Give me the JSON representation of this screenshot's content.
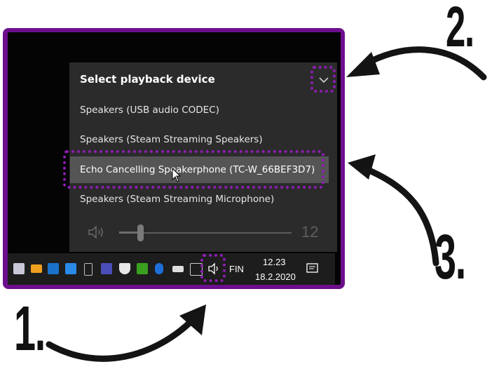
{
  "flyout": {
    "title": "Select playback device",
    "devices": [
      {
        "label": "Speakers (USB audio CODEC)",
        "selected": false
      },
      {
        "label": "Speakers (Steam Streaming Speakers)",
        "selected": false
      },
      {
        "label": "Echo Cancelling Speakerphone (TC-W_66BEF3D7)",
        "selected": true
      },
      {
        "label": "Speakers (Steam Streaming Microphone)",
        "selected": false
      }
    ],
    "volume": {
      "value": "12",
      "level_fraction": 0.12
    }
  },
  "taskbar": {
    "language": "FIN",
    "time": "12.23",
    "date": "18.2.2020",
    "icons": [
      "office-upload-icon",
      "mail-icon",
      "outlook-icon",
      "flash-icon",
      "usb-drive-icon",
      "teams-icon",
      "defender-shield-icon",
      "nvidia-icon",
      "bluetooth-icon",
      "battery-icon",
      "network-icon",
      "volume-icon",
      "notification-icon"
    ]
  },
  "callouts": {
    "one": "1.",
    "two": "2.",
    "three": "3."
  },
  "colors": {
    "highlight": "#8e1cb5",
    "frame": "#6d0f8c",
    "flyout_bg": "#2b2b2b",
    "selected_bg": "#555555",
    "taskbar_bg": "#1d1d1d"
  }
}
